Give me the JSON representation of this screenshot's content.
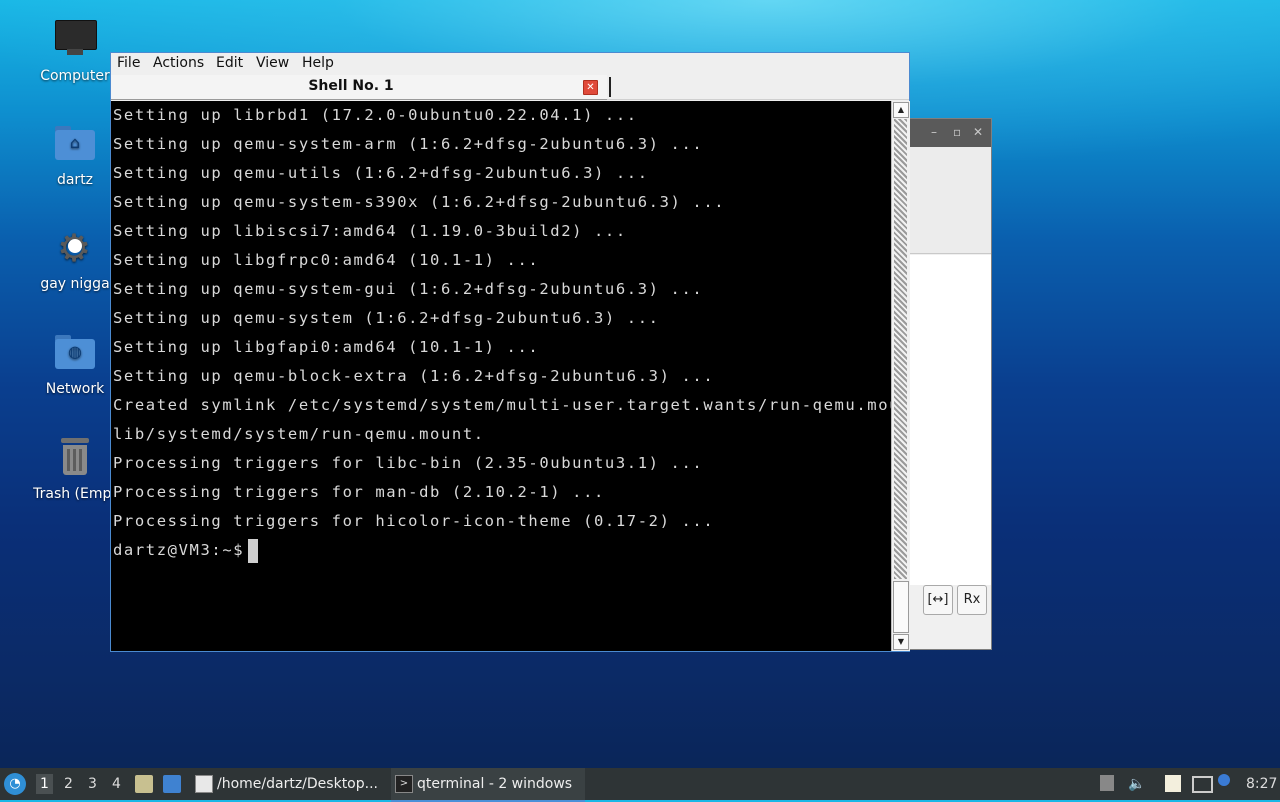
{
  "desktop": {
    "icons": [
      {
        "label": "Computer"
      },
      {
        "label": "dartz"
      },
      {
        "label": "gay nigga"
      },
      {
        "label": "Network"
      },
      {
        "label": "Trash (Empt"
      }
    ]
  },
  "terminal": {
    "menu": [
      "File",
      "Actions",
      "Edit",
      "View",
      "Help"
    ],
    "tab_title": "Shell No. 1",
    "lines": [
      "Setting up librbd1 (17.2.0-0ubuntu0.22.04.1) ...",
      "Setting up qemu-system-arm (1:6.2+dfsg-2ubuntu6.3) ...",
      "Setting up qemu-utils (1:6.2+dfsg-2ubuntu6.3) ...",
      "Setting up qemu-system-s390x (1:6.2+dfsg-2ubuntu6.3) ...",
      "Setting up libiscsi7:amd64 (1.19.0-3build2) ...",
      "Setting up libgfrpc0:amd64 (10.1-1) ...",
      "Setting up qemu-system-gui (1:6.2+dfsg-2ubuntu6.3) ...",
      "Setting up qemu-system (1:6.2+dfsg-2ubuntu6.3) ...",
      "Setting up libgfapi0:amd64 (10.1-1) ...",
      "Setting up qemu-block-extra (1:6.2+dfsg-2ubuntu6.3) ...",
      "Created symlink /etc/systemd/system/multi-user.target.wants/run-qemu.mount → /",
      "lib/systemd/system/run-qemu.mount.",
      "Processing triggers for libc-bin (2.35-0ubuntu3.1) ...",
      "Processing triggers for man-db (2.10.2-1) ...",
      "Processing triggers for hicolor-icon-theme (0.17-2) ..."
    ],
    "prompt": "dartz@VM3:~$"
  },
  "background_window": {
    "buttons": [
      "[↔]",
      "Rx"
    ]
  },
  "taskbar": {
    "workspaces": [
      "1",
      "2",
      "3",
      "4"
    ],
    "tasks": [
      {
        "label": "/home/dartz/Desktop..."
      },
      {
        "label": "qterminal - 2 windows"
      }
    ],
    "clock": "8:27"
  }
}
